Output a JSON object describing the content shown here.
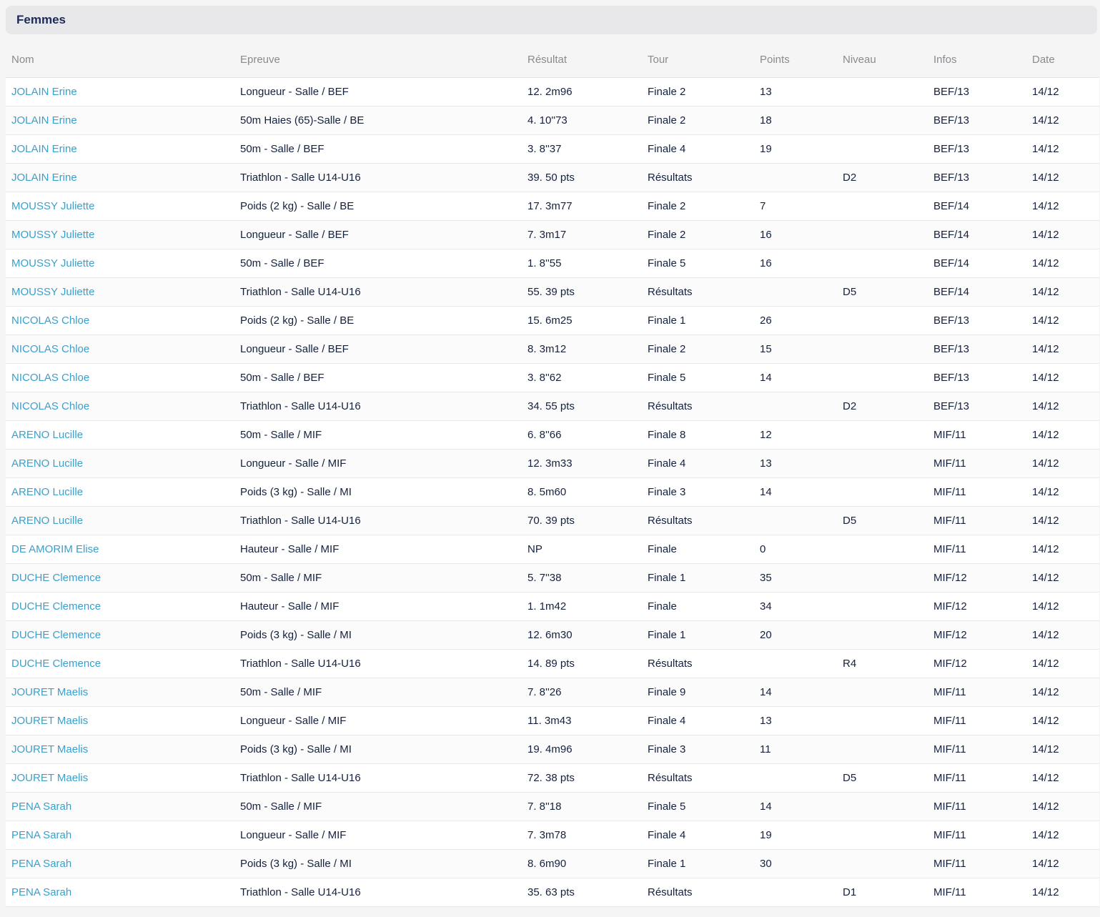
{
  "section": {
    "title": "Femmes"
  },
  "columns": [
    "Nom",
    "Epreuve",
    "Résultat",
    "Tour",
    "Points",
    "Niveau",
    "Infos",
    "Date"
  ],
  "rows": [
    [
      "JOLAIN Erine",
      "Longueur - Salle / BEF",
      "12. 2m96",
      "Finale 2",
      "13",
      "",
      "BEF/13",
      "14/12"
    ],
    [
      "JOLAIN Erine",
      "50m Haies (65)-Salle / BE",
      "4. 10''73",
      "Finale 2",
      "18",
      "",
      "BEF/13",
      "14/12"
    ],
    [
      "JOLAIN Erine",
      "50m - Salle / BEF",
      "3. 8''37",
      "Finale 4",
      "19",
      "",
      "BEF/13",
      "14/12"
    ],
    [
      "JOLAIN Erine",
      "Triathlon - Salle U14-U16",
      "39. 50 pts",
      "Résultats",
      "",
      "D2",
      "BEF/13",
      "14/12"
    ],
    [
      "MOUSSY Juliette",
      "Poids (2 kg) - Salle / BE",
      "17. 3m77",
      "Finale 2",
      "7",
      "",
      "BEF/14",
      "14/12"
    ],
    [
      "MOUSSY Juliette",
      "Longueur - Salle / BEF",
      "7. 3m17",
      "Finale 2",
      "16",
      "",
      "BEF/14",
      "14/12"
    ],
    [
      "MOUSSY Juliette",
      "50m - Salle / BEF",
      "1. 8''55",
      "Finale 5",
      "16",
      "",
      "BEF/14",
      "14/12"
    ],
    [
      "MOUSSY Juliette",
      "Triathlon - Salle U14-U16",
      "55. 39 pts",
      "Résultats",
      "",
      "D5",
      "BEF/14",
      "14/12"
    ],
    [
      "NICOLAS Chloe",
      "Poids (2 kg) - Salle / BE",
      "15. 6m25",
      "Finale 1",
      "26",
      "",
      "BEF/13",
      "14/12"
    ],
    [
      "NICOLAS Chloe",
      "Longueur - Salle / BEF",
      "8. 3m12",
      "Finale 2",
      "15",
      "",
      "BEF/13",
      "14/12"
    ],
    [
      "NICOLAS Chloe",
      "50m - Salle / BEF",
      "3. 8''62",
      "Finale 5",
      "14",
      "",
      "BEF/13",
      "14/12"
    ],
    [
      "NICOLAS Chloe",
      "Triathlon - Salle U14-U16",
      "34. 55 pts",
      "Résultats",
      "",
      "D2",
      "BEF/13",
      "14/12"
    ],
    [
      "ARENO Lucille",
      "50m - Salle / MIF",
      "6. 8''66",
      "Finale 8",
      "12",
      "",
      "MIF/11",
      "14/12"
    ],
    [
      "ARENO Lucille",
      "Longueur - Salle / MIF",
      "12. 3m33",
      "Finale 4",
      "13",
      "",
      "MIF/11",
      "14/12"
    ],
    [
      "ARENO Lucille",
      "Poids (3 kg) - Salle / MI",
      "8. 5m60",
      "Finale 3",
      "14",
      "",
      "MIF/11",
      "14/12"
    ],
    [
      "ARENO Lucille",
      "Triathlon - Salle U14-U16",
      "70. 39 pts",
      "Résultats",
      "",
      "D5",
      "MIF/11",
      "14/12"
    ],
    [
      "DE AMORIM Elise",
      "Hauteur - Salle / MIF",
      "NP",
      "Finale",
      "0",
      "",
      "MIF/11",
      "14/12"
    ],
    [
      "DUCHE Clemence",
      "50m - Salle / MIF",
      "5. 7''38",
      "Finale 1",
      "35",
      "",
      "MIF/12",
      "14/12"
    ],
    [
      "DUCHE Clemence",
      "Hauteur - Salle / MIF",
      "1. 1m42",
      "Finale",
      "34",
      "",
      "MIF/12",
      "14/12"
    ],
    [
      "DUCHE Clemence",
      "Poids (3 kg) - Salle / MI",
      "12. 6m30",
      "Finale 1",
      "20",
      "",
      "MIF/12",
      "14/12"
    ],
    [
      "DUCHE Clemence",
      "Triathlon - Salle U14-U16",
      "14. 89 pts",
      "Résultats",
      "",
      "R4",
      "MIF/12",
      "14/12"
    ],
    [
      "JOURET Maelis",
      "50m - Salle / MIF",
      "7. 8''26",
      "Finale 9",
      "14",
      "",
      "MIF/11",
      "14/12"
    ],
    [
      "JOURET Maelis",
      "Longueur - Salle / MIF",
      "11. 3m43",
      "Finale 4",
      "13",
      "",
      "MIF/11",
      "14/12"
    ],
    [
      "JOURET Maelis",
      "Poids (3 kg) - Salle / MI",
      "19. 4m96",
      "Finale 3",
      "11",
      "",
      "MIF/11",
      "14/12"
    ],
    [
      "JOURET Maelis",
      "Triathlon - Salle U14-U16",
      "72. 38 pts",
      "Résultats",
      "",
      "D5",
      "MIF/11",
      "14/12"
    ],
    [
      "PENA Sarah",
      "50m - Salle / MIF",
      "7. 8''18",
      "Finale 5",
      "14",
      "",
      "MIF/11",
      "14/12"
    ],
    [
      "PENA Sarah",
      "Longueur - Salle / MIF",
      "7. 3m78",
      "Finale 4",
      "19",
      "",
      "MIF/11",
      "14/12"
    ],
    [
      "PENA Sarah",
      "Poids (3 kg) - Salle / MI",
      "8. 6m90",
      "Finale 1",
      "30",
      "",
      "MIF/11",
      "14/12"
    ],
    [
      "PENA Sarah",
      "Triathlon - Salle U14-U16",
      "35. 63 pts",
      "Résultats",
      "",
      "D1",
      "MIF/11",
      "14/12"
    ]
  ],
  "colors": {
    "link": "#3aa0cc",
    "text": "#14213d",
    "header_text": "#8a8a8f",
    "section_bg": "#e8e8ea"
  }
}
